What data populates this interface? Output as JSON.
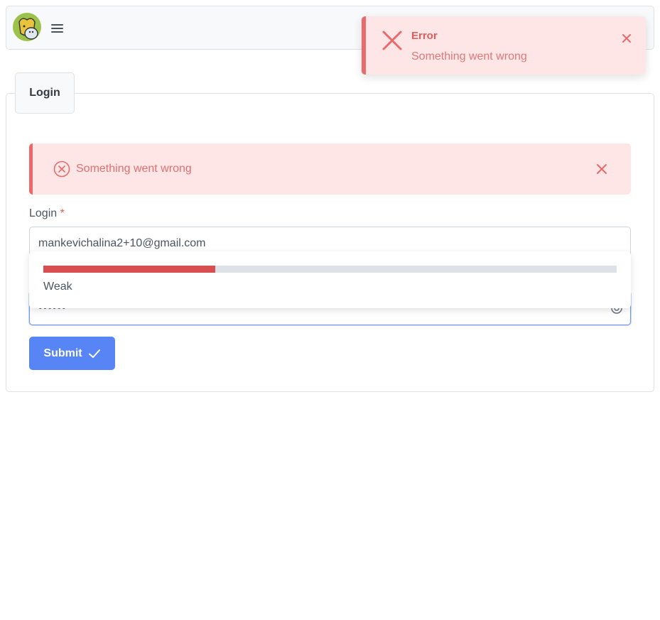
{
  "header": {
    "logo_icon": "pets-logo-icon",
    "menu_icon": "hamburger-icon"
  },
  "toast": {
    "title": "Error",
    "detail": "Something went wrong",
    "icon": "x-icon",
    "color": "#e86a6a"
  },
  "panel": {
    "tab_label": "Login"
  },
  "message": {
    "text": "Something went wrong",
    "icon": "x-circle-icon"
  },
  "form": {
    "login_label": "Login",
    "required_mark": "*",
    "email_value": "mankevichalina2+10@gmail.com",
    "password_value": "••••••",
    "strength": {
      "label": "Weak",
      "level_fraction": 0.3,
      "color": "#d94f4f"
    },
    "submit_label": "Submit"
  },
  "colors": {
    "accent": "#5885f5",
    "error_bg": "#ffe6e6",
    "error_text": "#e07070"
  }
}
